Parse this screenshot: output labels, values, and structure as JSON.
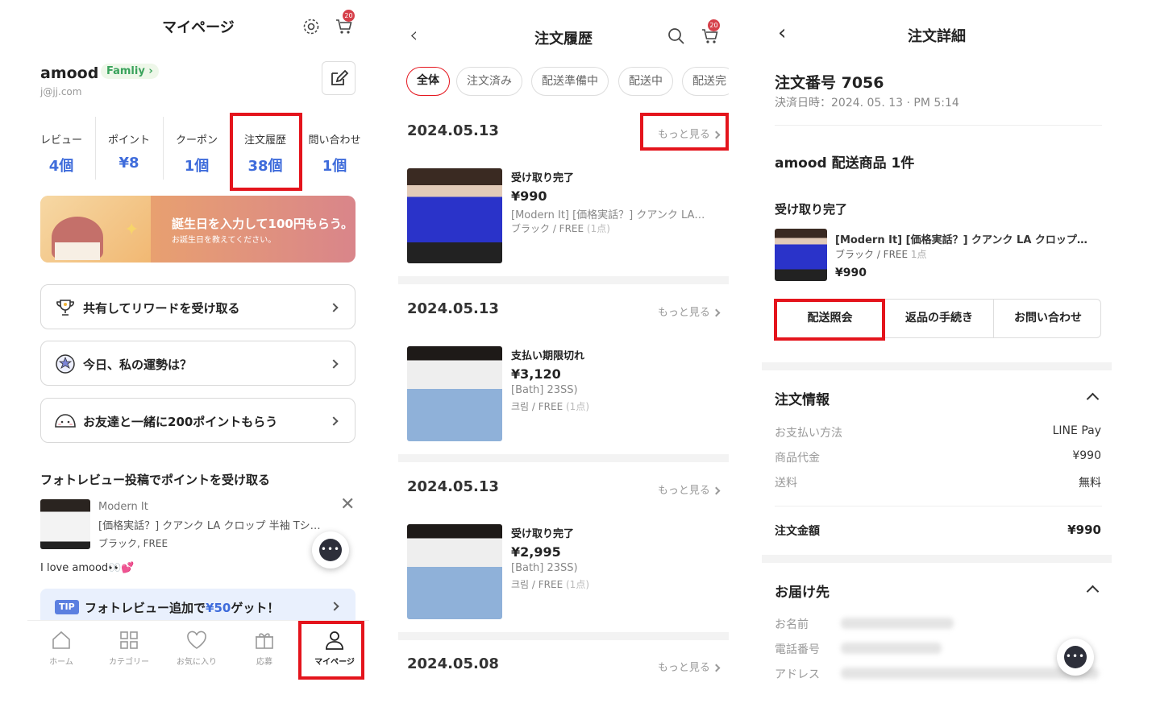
{
  "p1": {
    "title": "マイページ",
    "cart_count": "20",
    "user": {
      "name": "amood",
      "badge": "Famliy ›",
      "email": "j@jj.com"
    },
    "stats": [
      {
        "label": "レビュー",
        "value": "4個"
      },
      {
        "label": "ポイント",
        "value": "¥8"
      },
      {
        "label": "クーポン",
        "value": "1個"
      },
      {
        "label": "注文履歴",
        "value": "38個"
      },
      {
        "label": "問い合わせ",
        "value": "1個"
      }
    ],
    "banner": {
      "title": "誕生日を入力して100円もらう。",
      "subtitle": "お誕生日を教えてください。"
    },
    "menu": [
      {
        "label": "共有してリワードを受け取る",
        "icon": "trophy-icon"
      },
      {
        "label": "今日、私の運勢は？",
        "icon": "fortune-icon"
      },
      {
        "label": "お友達と一緒に200ポイントもらう",
        "icon": "friends-icon"
      }
    ],
    "photo_section_title": "フォトレビュー投稿でポイントを受け取る",
    "review": {
      "brand": "Modern It",
      "name": "[価格実話？] クアンク LA クロップ 半袖 Tシ…",
      "option": "ブラック, FREE",
      "comment": "I love amood👀💕"
    },
    "tip": {
      "badge": "TIP",
      "text_before": "フォトレビュー追加で",
      "highlight": "¥50",
      "text_after": "ゲット！"
    },
    "nav": [
      {
        "label": "ホーム",
        "icon": "home-icon"
      },
      {
        "label": "カテゴリー",
        "icon": "category-icon"
      },
      {
        "label": "お気に入り",
        "icon": "heart-icon"
      },
      {
        "label": "応募",
        "icon": "gift-icon"
      },
      {
        "label": "マイページ",
        "icon": "person-icon"
      }
    ]
  },
  "p2": {
    "title": "注文履歴",
    "cart_count": "20",
    "filters": [
      "全体",
      "注文済み",
      "配送準備中",
      "配送中",
      "配送完"
    ],
    "more_label": "もっと見る",
    "orders": [
      {
        "date": "2024.05.13",
        "status": "受け取り完了",
        "price": "¥990",
        "name": "[Modern It] [価格実話？] クアンク LA…",
        "option": "ブラック / FREE",
        "qty": "(1点)"
      },
      {
        "date": "2024.05.13",
        "status": "支払い期限切れ",
        "price": "¥3,120",
        "name": "[Bath] 23SS)",
        "option": "크림 / FREE",
        "qty": "(1点)"
      },
      {
        "date": "2024.05.13",
        "status": "受け取り完了",
        "price": "¥2,995",
        "name": "[Bath] 23SS)",
        "option": "크림 / FREE",
        "qty": "(1点)"
      },
      {
        "date": "2024.05.08"
      }
    ]
  },
  "p3": {
    "title": "注文詳細",
    "order_number": "注文番号 7056",
    "paid_at": "決済日時：2024. 05. 13 · PM 5:14",
    "shop_heading": "amood 配送商品 1件",
    "status": "受け取り完了",
    "product": {
      "name": "[Modern It] [価格実話？] クアンク LA クロップ…",
      "option": "ブラック / FREE",
      "qty": "1点",
      "price": "¥990"
    },
    "buttons": [
      "配送照会",
      "返品の手続き",
      "お問い合わせ"
    ],
    "order_info": {
      "heading": "注文情報",
      "rows": [
        {
          "label": "お支払い方法",
          "value": "LINE Pay"
        },
        {
          "label": "商品代金",
          "value": "¥990"
        },
        {
          "label": "送料",
          "value": "無料"
        }
      ],
      "total_label": "注文金額",
      "total_value": "¥990"
    },
    "delivery": {
      "heading": "お届け先",
      "labels": [
        "お名前",
        "電話番号",
        "アドレス"
      ]
    }
  },
  "colors": {
    "accent": "#e4141c",
    "blue": "#3f6cdb",
    "green": "#3aa35c"
  }
}
